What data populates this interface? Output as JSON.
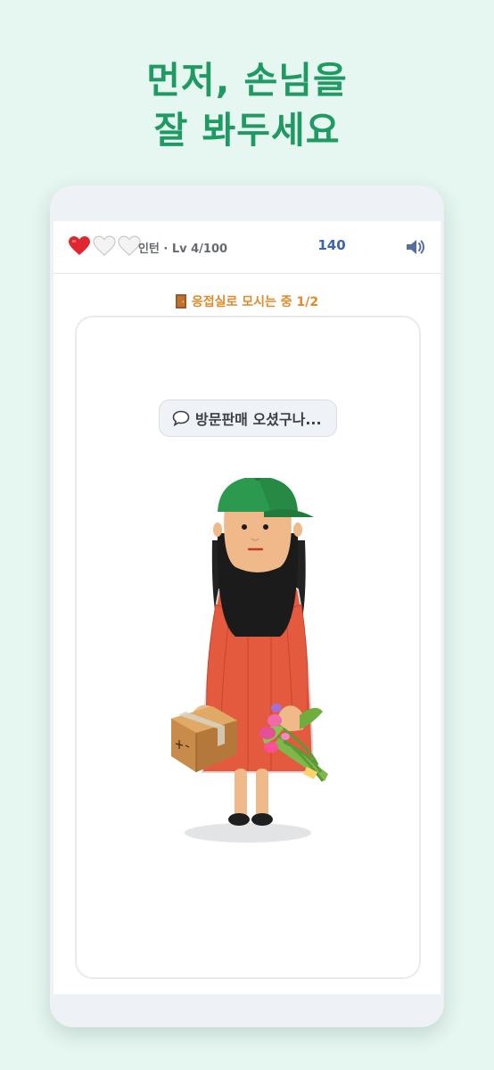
{
  "headline": {
    "line1": "먼저, 손님을",
    "line2": "잘 봐두세요"
  },
  "game": {
    "lives_total": 3,
    "lives_remaining": 1,
    "level_text": "인턴 · Lv 4/100",
    "score": "140",
    "status_text": "응접실로 모시는 중 1/2",
    "speech_text": "방문판매 오셨구나..."
  },
  "colors": {
    "accent_green": "#1f9a63",
    "score_blue": "#3d63b8",
    "status_orange": "#e3892a",
    "heart_red": "#e0262f"
  },
  "icons": [
    "heart-icon",
    "sound-icon",
    "door-icon",
    "speech-bubble-icon"
  ]
}
